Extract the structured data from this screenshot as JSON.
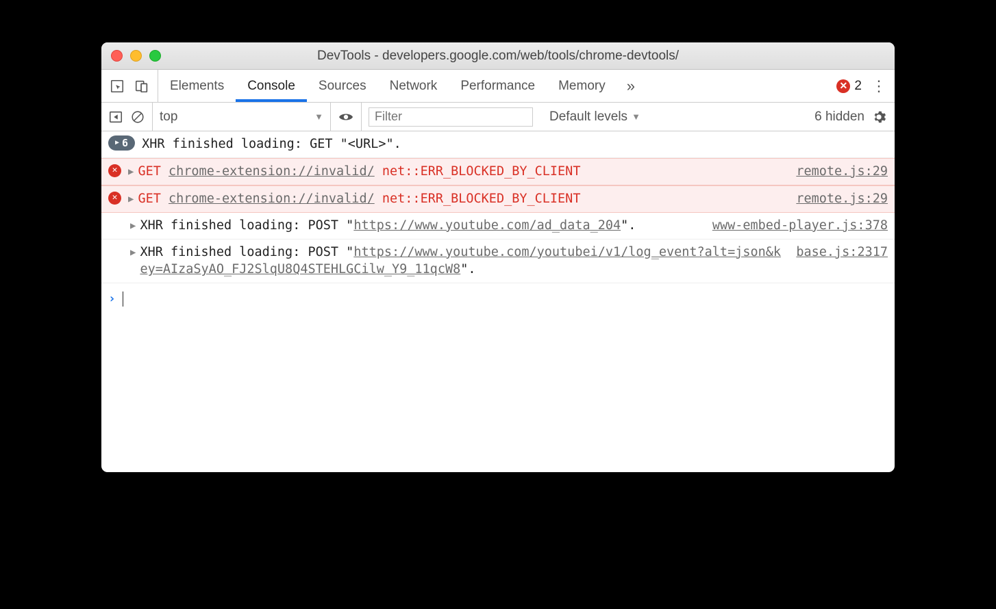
{
  "window": {
    "title": "DevTools - developers.google.com/web/tools/chrome-devtools/"
  },
  "tabs": {
    "items": [
      "Elements",
      "Console",
      "Sources",
      "Network",
      "Performance",
      "Memory"
    ],
    "active": "Console",
    "error_count": "2"
  },
  "toolbar": {
    "context": "top",
    "filter_placeholder": "Filter",
    "levels": "Default levels",
    "hidden": "6 hidden"
  },
  "messages": {
    "group_count": "6",
    "group_text": "XHR finished loading: GET \"<URL>\".",
    "err1": {
      "method": "GET",
      "url": "chrome-extension://invalid/",
      "code": "net::ERR_BLOCKED_BY_CLIENT",
      "src": "remote.js:29"
    },
    "err2": {
      "method": "GET",
      "url": "chrome-extension://invalid/",
      "code": "net::ERR_BLOCKED_BY_CLIENT",
      "src": "remote.js:29"
    },
    "xhr1": {
      "prefix": "XHR finished loading: POST \"",
      "url": "https://www.youtube.com/ad_data_204",
      "suffix": "\".",
      "src": "www-embed-player.js:378"
    },
    "xhr2": {
      "prefix": "XHR finished loading: POST \"",
      "url": "https://www.youtube.com/youtubei/v1/log_event?alt=json&key=AIzaSyAO_FJ2SlqU8Q4STEHLGCilw_Y9_11qcW8",
      "suffix": "\".",
      "src": "base.js:2317"
    }
  }
}
